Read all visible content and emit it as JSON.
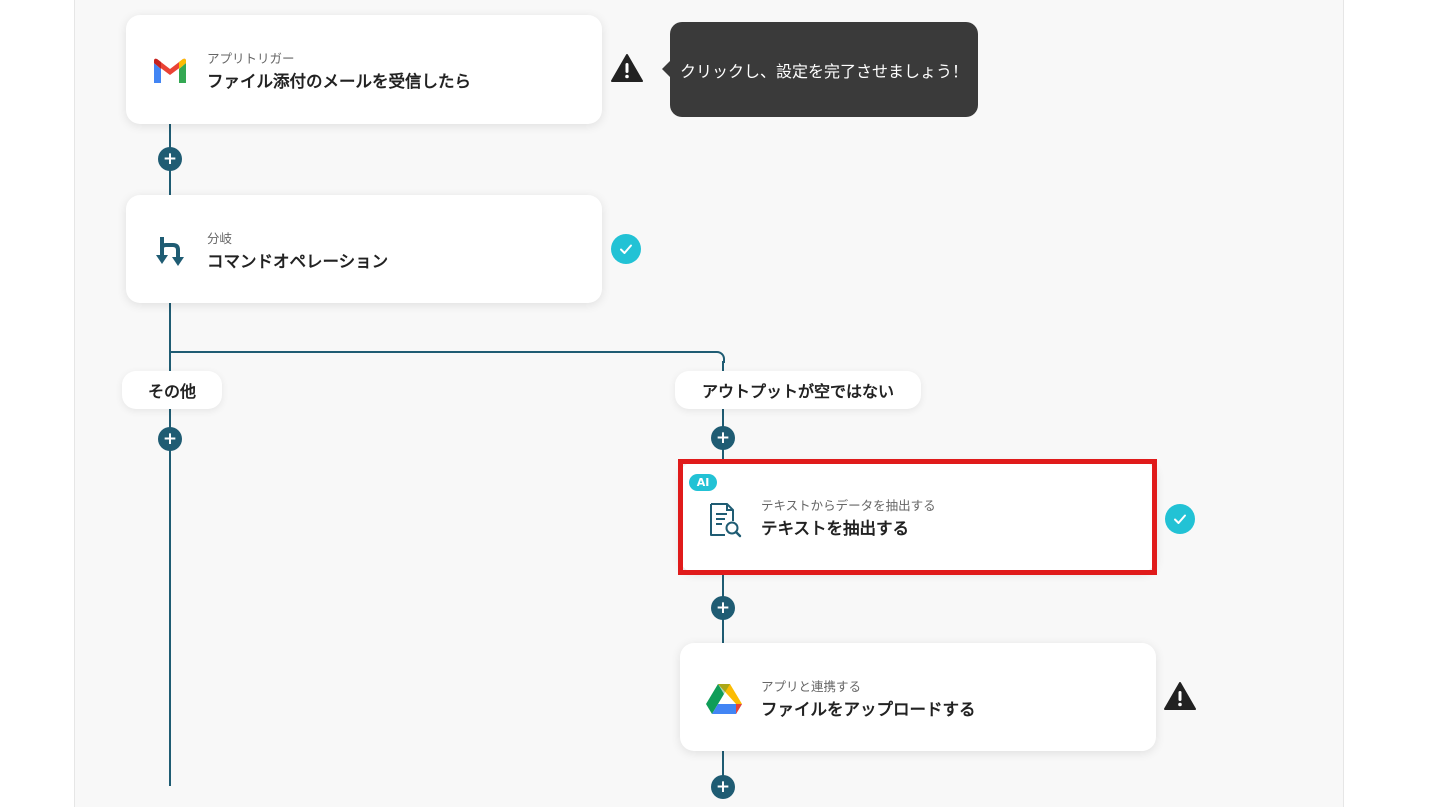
{
  "flow": {
    "steps": [
      {
        "subtitle": "アプリトリガー",
        "title": "ファイル添付のメールを受信したら",
        "icon": "gmail-icon",
        "status": "warning"
      },
      {
        "subtitle": "分岐",
        "title": "コマンドオペレーション",
        "icon": "branch-icon",
        "status": "done"
      },
      {
        "badge": "AI",
        "subtitle": "テキストからデータを抽出する",
        "title": "テキストを抽出する",
        "icon": "document-search-icon",
        "status": "done",
        "highlighted": true
      },
      {
        "subtitle": "アプリと連携する",
        "title": "ファイルをアップロードする",
        "icon": "google-drive-icon",
        "status": "warning"
      }
    ],
    "branches": [
      "その他",
      "アウトプットが空ではない"
    ],
    "tooltip": "クリックし、設定を完了させましょう！",
    "add_symbol": "+"
  },
  "colors": {
    "connector": "#1f5c73",
    "done": "#22c2d5",
    "warning": "#222222",
    "highlight": "#e01b1b",
    "tooltip_bg": "#3a3a3a"
  }
}
